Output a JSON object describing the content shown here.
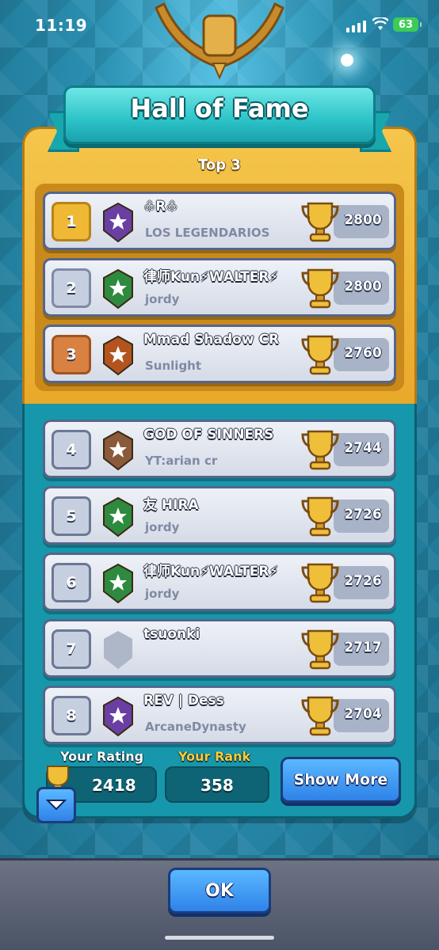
{
  "status_bar": {
    "time": "11:19",
    "battery": "63"
  },
  "header": {
    "title": "Hall of Fame",
    "subtitle": "Top 3"
  },
  "rows": [
    {
      "rank": "1",
      "name": "♧R♧",
      "clan": "LOS LEGENDARIOS",
      "trophies": "2800",
      "rank_style": "gold",
      "badge_color": "#6a3fa3"
    },
    {
      "rank": "2",
      "name": "律师Kun⚡WALTER⚡",
      "clan": "jordy",
      "trophies": "2800",
      "rank_style": "silver",
      "badge_color": "#2e8a3e"
    },
    {
      "rank": "3",
      "name": "Mmad Shadow CR",
      "clan": "Sunlight",
      "trophies": "2760",
      "rank_style": "bronze",
      "badge_color": "#b3541e"
    },
    {
      "rank": "4",
      "name": "GOD OF SINNERS",
      "clan": "YT:arian cr",
      "trophies": "2744",
      "rank_style": "plain",
      "badge_color": "#8a5a3b"
    },
    {
      "rank": "5",
      "name": "友 HIRA",
      "clan": "jordy",
      "trophies": "2726",
      "rank_style": "plain",
      "badge_color": "#2e8a3e"
    },
    {
      "rank": "6",
      "name": "律师Kun⚡WALTER⚡",
      "clan": "jordy",
      "trophies": "2726",
      "rank_style": "plain",
      "badge_color": "#2e8a3e"
    },
    {
      "rank": "7",
      "name": "tsuonki",
      "clan": "",
      "trophies": "2717",
      "rank_style": "plain",
      "badge_color": "#aeb7c8"
    },
    {
      "rank": "8",
      "name": "REV | Dess",
      "clan": "ArcaneDynasty",
      "trophies": "2704",
      "rank_style": "plain",
      "badge_color": "#6a3fa3"
    }
  ],
  "footer": {
    "your_rating_label": "Your Rating",
    "your_rating": "2418",
    "your_rank_label": "Your Rank",
    "your_rank": "358",
    "show_more": "Show More"
  },
  "ok_button": "OK"
}
